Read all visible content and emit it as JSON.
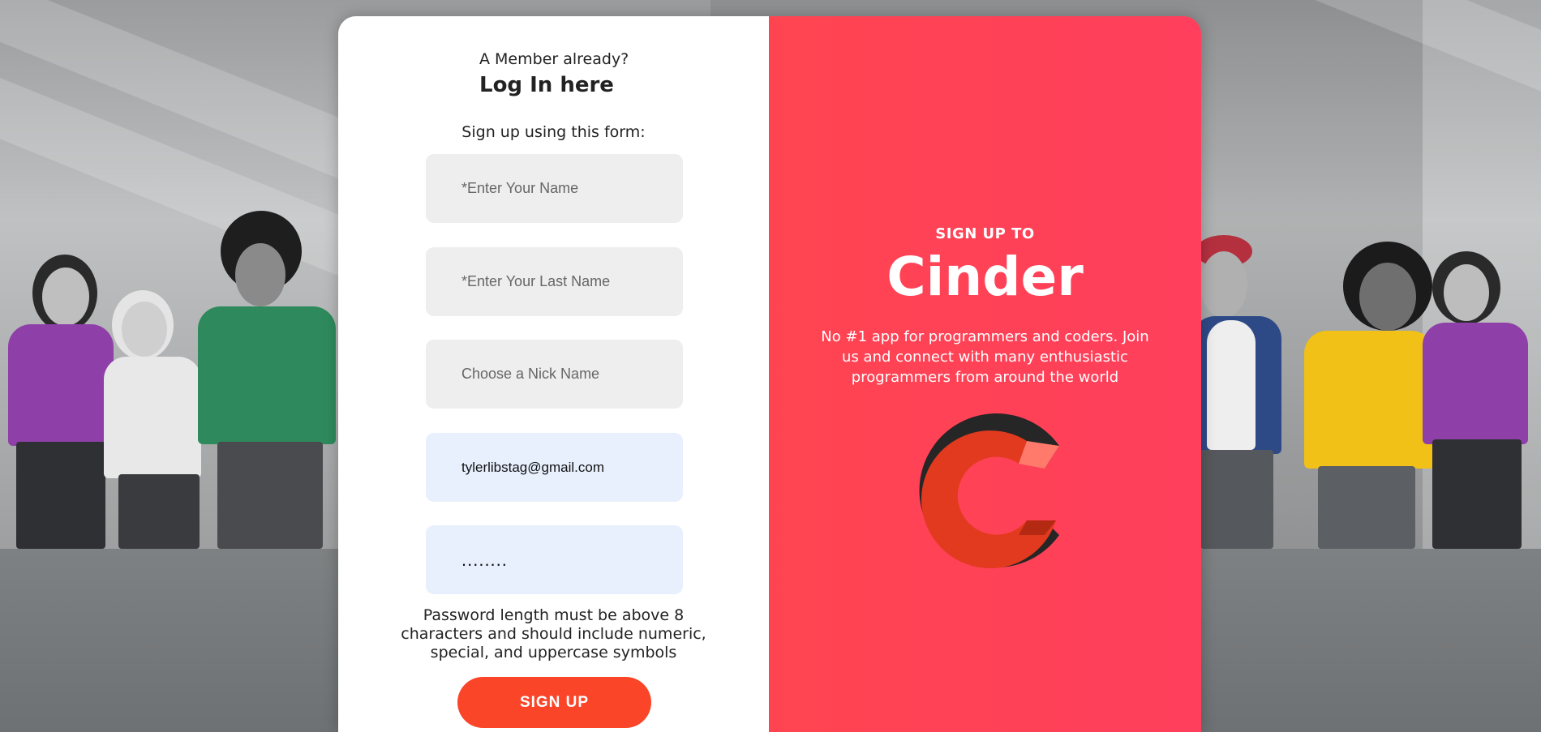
{
  "login": {
    "question": "A Member already?",
    "link": "Log In here"
  },
  "form": {
    "caption": "Sign up using this form:",
    "first_name_placeholder": "*Enter Your Name",
    "last_name_placeholder": "*Enter Your Last Name",
    "nickname_placeholder": "Choose a Nick Name",
    "email_value": "tylerlibstag@gmail.com",
    "password_value": "........",
    "password_note": "Password length must be above 8 characters and should include numeric, special, and uppercase symbols",
    "submit_label": "SIGN UP"
  },
  "promo": {
    "heading": "SIGN UP TO",
    "brand": "Cinder",
    "tagline": "No #1 app for programmers and coders. Join us and connect with many enthusiastic programmers from around the world",
    "logo_icon": "cinder-c-logo-icon"
  },
  "colors": {
    "accent": "#ff4451",
    "button": "#fa4529",
    "field": "#eeeeee",
    "field_autofill": "#e8f0fe"
  }
}
